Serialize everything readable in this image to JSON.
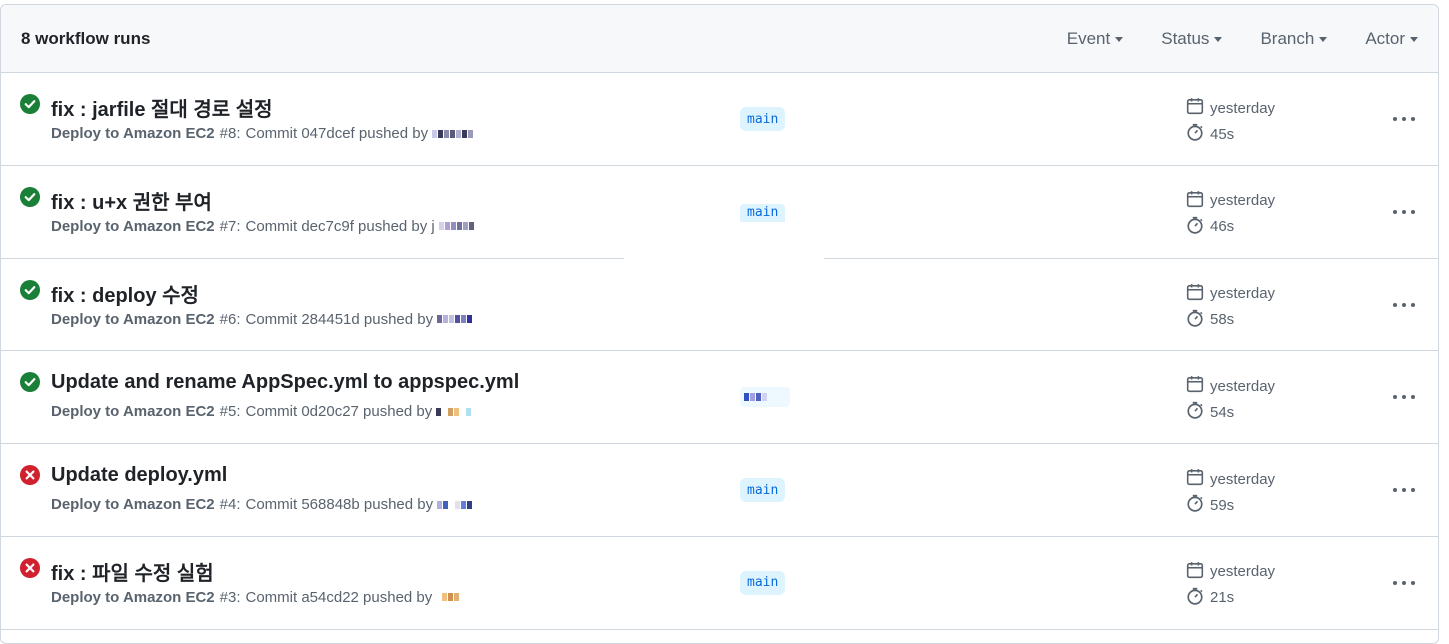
{
  "header": {
    "title": "8 workflow runs",
    "filters": [
      {
        "label": "Event"
      },
      {
        "label": "Status"
      },
      {
        "label": "Branch"
      },
      {
        "label": "Actor"
      }
    ]
  },
  "colors": {
    "success": "#1a7f37",
    "failure": "#cf222e",
    "branch_bg": "#ddf4ff",
    "branch_fg": "#0969da"
  },
  "runs": [
    {
      "status": "success",
      "title": "fix : jarfile 절대 경로 설정",
      "workflow": "Deploy to Amazon EC2",
      "run_number": "#8:",
      "commit_text": "Commit 047dcef pushed by",
      "branch": "main",
      "when": "yesterday",
      "duration": "45s"
    },
    {
      "status": "success",
      "title": "fix : u+x 권한 부여",
      "workflow": "Deploy to Amazon EC2",
      "run_number": "#7:",
      "commit_text": "Commit dec7c9f pushed by j",
      "branch": "main",
      "when": "yesterday",
      "duration": "46s"
    },
    {
      "status": "success",
      "title": "fix : deploy 수정",
      "workflow": "Deploy to Amazon EC2",
      "run_number": "#6:",
      "commit_text": "Commit 284451d pushed by",
      "branch": "",
      "when": "yesterday",
      "duration": "58s"
    },
    {
      "status": "success",
      "title": "Update and rename AppSpec.yml to appspec.yml",
      "workflow": "Deploy to Amazon EC2",
      "run_number": "#5:",
      "commit_text": "Commit 0d20c27 pushed by",
      "branch": "",
      "when": "yesterday",
      "duration": "54s"
    },
    {
      "status": "failure",
      "title": "Update deploy.yml",
      "workflow": "Deploy to Amazon EC2",
      "run_number": "#4:",
      "commit_text": "Commit 568848b pushed by",
      "branch": "main",
      "when": "yesterday",
      "duration": "59s"
    },
    {
      "status": "failure",
      "title": "fix : 파일 수정 실험",
      "workflow": "Deploy to Amazon EC2",
      "run_number": "#3:",
      "commit_text": "Commit a54cd22 pushed by",
      "branch": "main",
      "when": "yesterday",
      "duration": "21s"
    }
  ]
}
